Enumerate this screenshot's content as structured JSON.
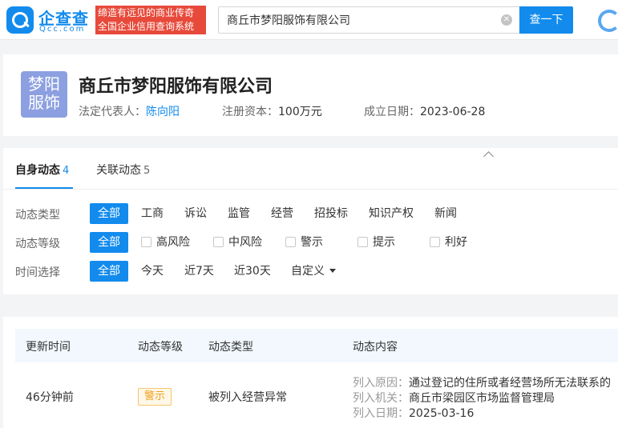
{
  "header": {
    "logo_cn": "企查查",
    "logo_en": "Qcc.com",
    "slogan_line1": "缔造有远见的商业传奇",
    "slogan_line2": "全国企业信用查询系统",
    "search_value": "商丘市梦阳服饰有限公司",
    "search_button": "查一下",
    "clear_icon": "✕"
  },
  "company": {
    "logo_line1": "梦阳",
    "logo_line2": "服饰",
    "name": "商丘市梦阳服饰有限公司",
    "legal_rep_label": "法定代表人：",
    "legal_rep": "陈向阳",
    "capital_label": "注册资本：",
    "capital": "100万元",
    "founded_label": "成立日期：",
    "founded": "2023-06-28"
  },
  "tabs": [
    {
      "label": "自身动态",
      "count": "4"
    },
    {
      "label": "关联动态",
      "count": "5"
    }
  ],
  "filters": {
    "type": {
      "label": "动态类型",
      "options": [
        "全部",
        "工商",
        "诉讼",
        "监管",
        "经营",
        "招投标",
        "知识产权",
        "新闻"
      ]
    },
    "level": {
      "label": "动态等级",
      "options": [
        "全部",
        "高风险",
        "中风险",
        "警示",
        "提示",
        "利好"
      ]
    },
    "time": {
      "label": "时间选择",
      "options": [
        "全部",
        "今天",
        "近7天",
        "近30天",
        "自定义"
      ]
    }
  },
  "table": {
    "headers": [
      "更新时间",
      "动态等级",
      "动态类型",
      "动态内容"
    ],
    "row": {
      "time": "46分钟前",
      "level": "警示",
      "type": "被列入经营异常",
      "details": [
        {
          "k": "列入原因：",
          "v": "通过登记的住所或者经营场所无法联系的"
        },
        {
          "k": "列入机关：",
          "v": "商丘市梁园区市场监督管理局"
        },
        {
          "k": "列入日期：",
          "v": "2025-03-16"
        }
      ]
    }
  },
  "colors": {
    "accent": "#128bed",
    "slogan_bg": "#e74a3b",
    "warning": "#f0a020"
  }
}
